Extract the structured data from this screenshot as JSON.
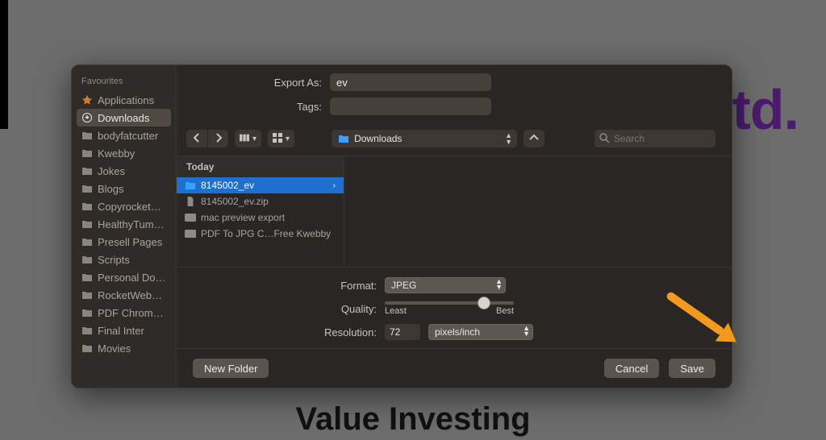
{
  "page": {
    "ltd_fragment": "Ltd.",
    "background_title": "Value Investing"
  },
  "sidebar": {
    "header": "Favourites",
    "items": [
      {
        "label": "Applications",
        "icon": "apps"
      },
      {
        "label": "Downloads",
        "icon": "download",
        "selected": true
      },
      {
        "label": "bodyfatcutter",
        "icon": "folder"
      },
      {
        "label": "Kwebby",
        "icon": "folder"
      },
      {
        "label": "Jokes",
        "icon": "folder"
      },
      {
        "label": "Blogs",
        "icon": "folder"
      },
      {
        "label": "Copyrocket…",
        "icon": "folder"
      },
      {
        "label": "HealthyTum…",
        "icon": "folder"
      },
      {
        "label": "Presell Pages",
        "icon": "folder"
      },
      {
        "label": "Scripts",
        "icon": "folder"
      },
      {
        "label": "Personal Do…",
        "icon": "folder"
      },
      {
        "label": "RocketWeb…",
        "icon": "folder"
      },
      {
        "label": "PDF Chrom…",
        "icon": "folder"
      },
      {
        "label": "Final Inter",
        "icon": "folder"
      },
      {
        "label": "Movies",
        "icon": "folder"
      }
    ]
  },
  "top": {
    "export_as_label": "Export As:",
    "export_as_value": "ev",
    "tags_label": "Tags:",
    "tags_value": ""
  },
  "toolbar": {
    "location_label": "Downloads",
    "search_placeholder": "Search"
  },
  "browser": {
    "group_header": "Today",
    "items": [
      {
        "label": "8145002_ev",
        "kind": "folder-blue",
        "selected": true,
        "has_children": true
      },
      {
        "label": "8145002_ev.zip",
        "kind": "file"
      },
      {
        "label": "mac preview export",
        "kind": "web"
      },
      {
        "label": "PDF To JPG C…Free  Kwebby",
        "kind": "web"
      }
    ]
  },
  "form": {
    "format_label": "Format:",
    "format_value": "JPEG",
    "quality_label": "Quality:",
    "quality_value": 80,
    "quality_min_label": "Least",
    "quality_max_label": "Best",
    "resolution_label": "Resolution:",
    "resolution_value": "72",
    "resolution_unit": "pixels/inch"
  },
  "footer": {
    "new_folder": "New Folder",
    "cancel": "Cancel",
    "save": "Save"
  }
}
